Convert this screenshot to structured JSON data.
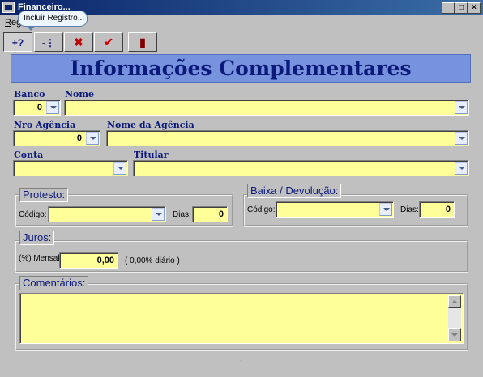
{
  "window": {
    "title": "Financeiro...",
    "minimize": "_",
    "maximize": "□",
    "close": "×"
  },
  "menu": {
    "item": "Registro"
  },
  "tooltip": "Incluir Registro...",
  "toolbar": {
    "buttons": [
      {
        "icon": "insert-record-icon",
        "glyph": "+?"
      },
      {
        "icon": "delete-row-icon",
        "glyph": "-⋮"
      },
      {
        "icon": "cancel-x-icon",
        "glyph": "✖"
      },
      {
        "icon": "confirm-check-icon",
        "glyph": "✔"
      },
      {
        "icon": "exit-door-icon",
        "glyph": "▮"
      }
    ]
  },
  "header": {
    "title": "Informações Complementares"
  },
  "fields": {
    "banco_label": "Banco",
    "banco_value": "0",
    "nome_label": "Nome",
    "nome_value": "",
    "nro_agencia_label": "Nro Agência",
    "nro_agencia_value": "0",
    "nome_agencia_label": "Nome da Agência",
    "nome_agencia_value": "",
    "conta_label": "Conta",
    "conta_value": "",
    "titular_label": "Titular",
    "titular_value": ""
  },
  "protesto": {
    "legend": "Protesto:",
    "codigo_label": "Código:",
    "codigo_value": "",
    "dias_label": "Dias:",
    "dias_value": "0"
  },
  "baixa": {
    "legend": "Baixa / Devolução:",
    "codigo_label": "Código:",
    "codigo_value": "",
    "dias_label": "Dias:",
    "dias_value": "0"
  },
  "juros": {
    "legend": "Juros:",
    "mensal_label": "(%) Mensal",
    "mensal_value": "0,00",
    "diario_text": "( 0,00% diário )"
  },
  "comentarios": {
    "legend": "Comentários:",
    "value": ""
  },
  "status": {
    "text": "."
  },
  "colors": {
    "field_bg": "#ffff99",
    "banner_bg": "#7793dd",
    "banner_text": "#0b1a7a",
    "window_bg": "#c0c0c0"
  }
}
